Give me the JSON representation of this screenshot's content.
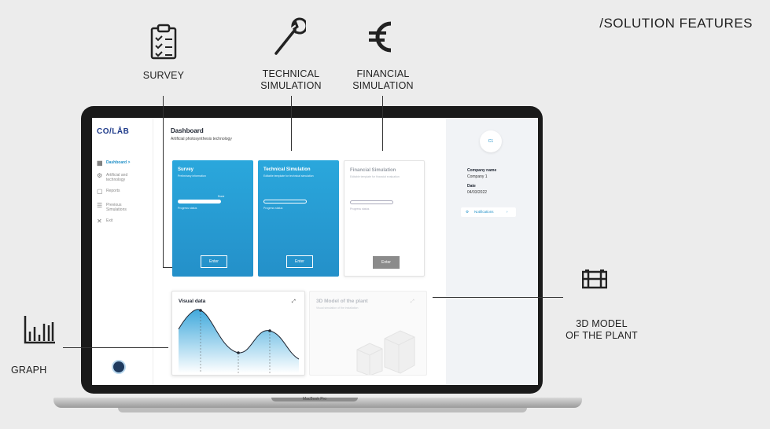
{
  "page": {
    "heading": "/SOLUTION FEATURES"
  },
  "features": {
    "survey": "SURVEY",
    "technical": [
      "TECHNICAL",
      "SIMULATION"
    ],
    "financial": [
      "FINANCIAL",
      "SIMULATION"
    ],
    "model": [
      "3D MODEL",
      "OF THE PLANT"
    ],
    "graph": "GRAPH"
  },
  "icons": {
    "survey": "clipboard-checklist-icon",
    "technical": "wrench-icon",
    "financial": "euro-icon",
    "model": "plant-icon",
    "graph": "bar-chart-icon"
  },
  "laptop": {
    "label": "MacBook Pro"
  },
  "app": {
    "logo": "CO/LÅB",
    "sidebar": {
      "items": [
        {
          "label": "Dashboard  >",
          "icon": "grid-icon",
          "active": true
        },
        {
          "label": "Artificial  and\ntechnology",
          "icon": "gear-icon"
        },
        {
          "label": "Reports",
          "icon": "document-icon"
        },
        {
          "label": "Previous\nSimulations",
          "icon": "list-icon"
        },
        {
          "label": "Exit",
          "icon": "close-icon"
        }
      ]
    },
    "header": {
      "title": "Dashboard",
      "subtitle": "Artificial photosynthesis technology"
    },
    "cards": [
      {
        "title": "Survey",
        "subtitle": "Preliminary information",
        "done": "Done",
        "progress": "Progress status",
        "button": "Enter",
        "progress_value": 1.0
      },
      {
        "title": "Technical Simulation",
        "subtitle": "Editable template for technical simulation",
        "progress": "Progress status",
        "button": "Enter",
        "progress_value": 0
      },
      {
        "title": "Financial Simulation",
        "subtitle": "Editable template for financial evaluation",
        "progress": "Progress status",
        "button": "Enter",
        "progress_value": 0
      }
    ],
    "visual": {
      "title": "Visual data"
    },
    "model": {
      "title": "3D Model of the plant",
      "subtitle": "Visual simulation of the installation"
    },
    "right_panel": {
      "avatar": "C1",
      "company_label": "Company name",
      "company_value": "Company 1",
      "date_label": "Date",
      "date_value": "04/03/2022",
      "notifications": "Notifications"
    }
  },
  "colors": {
    "accent": "#2aa7dc",
    "navy": "#1e3a8a"
  }
}
